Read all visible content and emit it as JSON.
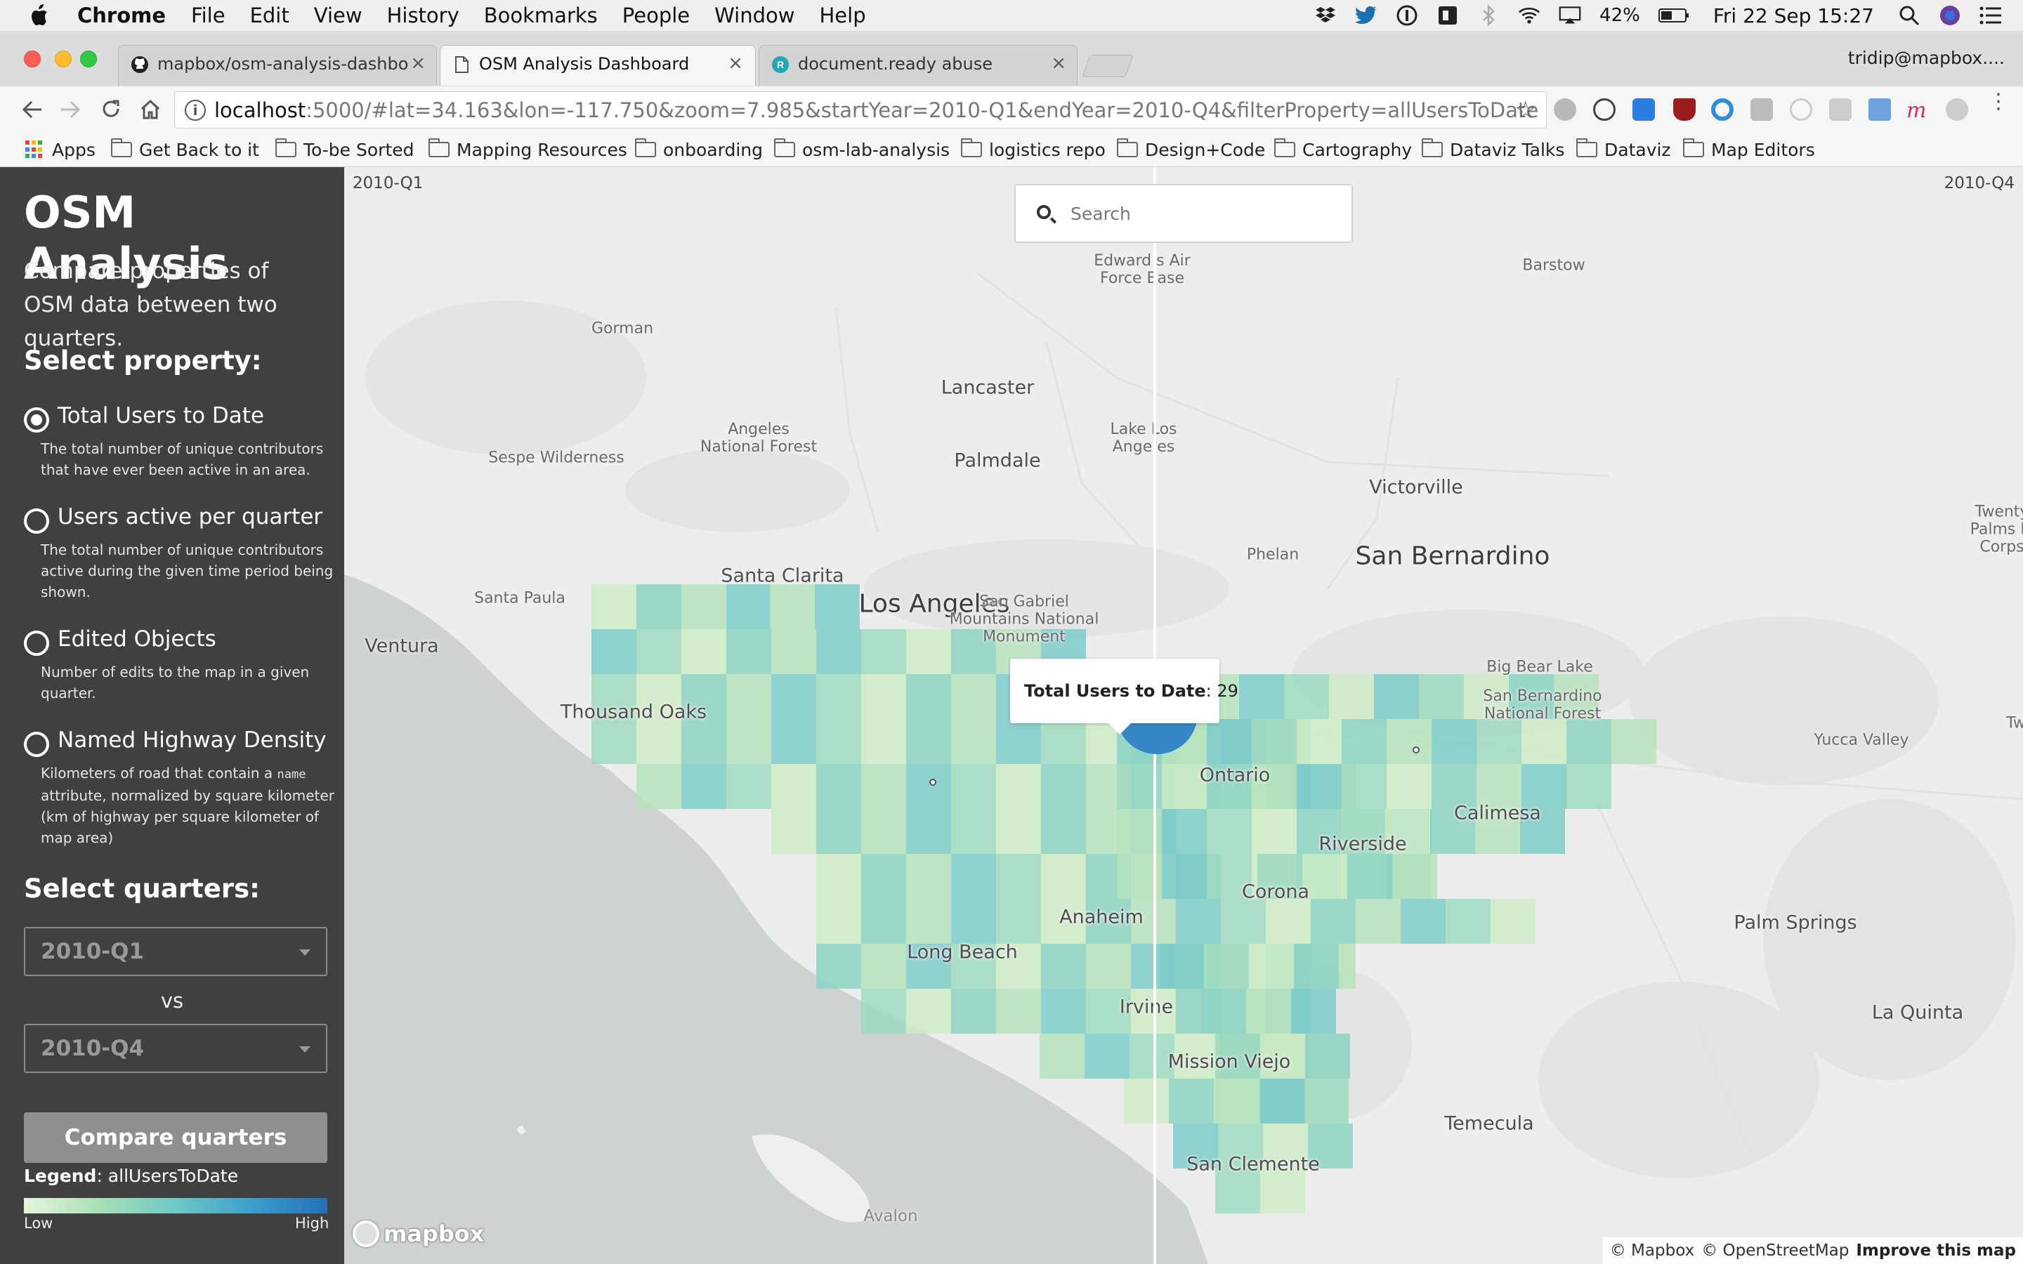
{
  "menubar": {
    "app_name": "Chrome",
    "items": [
      "File",
      "Edit",
      "View",
      "History",
      "Bookmarks",
      "People",
      "Window",
      "Help"
    ],
    "battery": "42%",
    "clock": "Fri 22 Sep  15:27"
  },
  "tabs": [
    {
      "title": "mapbox/osm-analysis-dashbo",
      "icon": "github-icon",
      "active": false
    },
    {
      "title": "OSM Analysis Dashboard",
      "icon": "page-icon",
      "active": true
    },
    {
      "title": "document.ready abuse",
      "icon": "r-site-icon",
      "active": false
    }
  ],
  "profile_name": "tridip@mapbox....",
  "omnibox": {
    "host": "localhost",
    "path": ":5000/#lat=34.163&lon=-117.750&zoom=7.985&startYear=2010-Q1&endYear=2010-Q4&filterProperty=allUsersToDate"
  },
  "bookmarks": [
    "Apps",
    "Get Back to it",
    "To-be Sorted",
    "Mapping Resources",
    "onboarding",
    "osm-lab-analysis",
    "logistics repo",
    "Design+Code",
    "Cartography",
    "Dataviz Talks",
    "Dataviz",
    "Map Editors"
  ],
  "sidebar": {
    "title": "OSM Analysis",
    "subtitle": "Compare properties of OSM data between two quarters.",
    "select_property_heading": "Select property:",
    "options": [
      {
        "label": "Total Users to Date",
        "description": "The total number of unique contributors that have ever been active in an area.",
        "checked": true
      },
      {
        "label": "Users active per quarter",
        "description": "The total number of unique contributors active during the given time period being shown.",
        "checked": false
      },
      {
        "label": "Edited Objects",
        "description": "Number of edits to the map in a given quarter.",
        "checked": false
      },
      {
        "label": "Named Highway Density",
        "description_before": "Kilometers of road that contain a ",
        "description_code": "name",
        "description_after": " attribute, normalized by square kilometer (km of highway per square kilometer of map area)",
        "checked": false
      }
    ],
    "select_quarters_heading": "Select quarters:",
    "quarter_start": "2010-Q1",
    "vs": "vs",
    "quarter_end": "2010-Q4",
    "compare_button": "Compare quarters",
    "legend_label": "Legend",
    "legend_value": ": allUsersToDate",
    "legend_low": "Low",
    "legend_high": "High",
    "legend_colors": [
      "#e6f6df",
      "#a8dfb6",
      "#6fc8c6",
      "#3e9fcb",
      "#2270b8"
    ]
  },
  "map": {
    "quarter_left": "2010-Q1",
    "quarter_right": "2010-Q4",
    "search_placeholder": "Search",
    "popup_label": "Total Users to Date",
    "popup_value": ": 29",
    "places": {
      "los_angeles": "Los Angeles",
      "san_bernardino": "San Bernardino",
      "lancaster": "Lancaster",
      "palmdale": "Palmdale",
      "victorville": "Victorville",
      "santa_clarita": "Santa Clarita",
      "ventura": "Ventura",
      "thousand_oaks": "Thousand Oaks",
      "ontario": "Ontario",
      "riverside": "Riverside",
      "corona": "Corona",
      "anaheim": "Anaheim",
      "long_beach": "Long Beach",
      "irvine": "Irvine",
      "mission_viejo": "Mission Viejo",
      "san_clemente": "San Clemente",
      "temecula": "Temecula",
      "palm_springs": "Palm Springs",
      "la_quinta": "La Quinta",
      "calimesa": "Calimesa",
      "yucca_valley": "Yucca Valley",
      "barstow": "Barstow",
      "gorman": "Gorman",
      "phelan": "Phelan",
      "big_bear_lake": "Big Bear Lake",
      "santa_paula": "Santa Paula",
      "sespe_wilderness": "Sespe Wilderness",
      "angeles_nf": "Angeles\nNational Forest",
      "lake_los_angeles": "Lake Los\nAnge es",
      "edwards_afb": "Edward s Air\nForce Base",
      "san_gabriel": "San Gabriel\nMountains National\nMonument",
      "san_bernardino_nf": "San Bernardino\nNational Forest",
      "twentynine_palms": "Twenty\nPalms M\nCorps",
      "tw": "Tw",
      "avalon": "Avalon"
    },
    "attribution": [
      "© Mapbox",
      "© OpenStreetMap"
    ],
    "improve_link": "Improve this map",
    "logo_text": "mapbox"
  }
}
